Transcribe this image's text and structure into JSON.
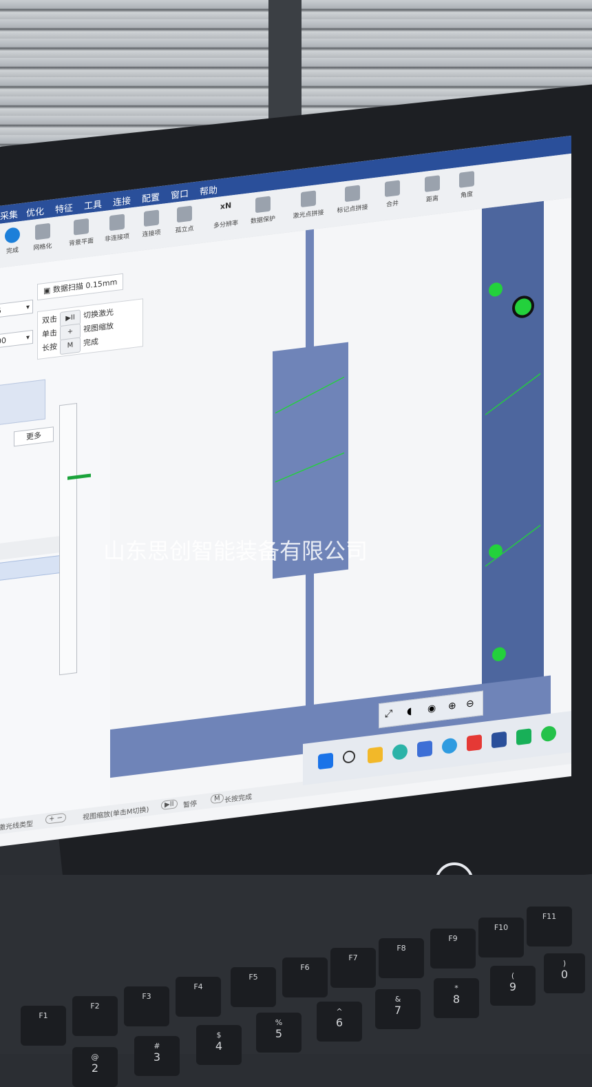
{
  "watermark": "山东思创智能装备有限公司",
  "menubar": {
    "items": [
      "采集",
      "优化",
      "特征",
      "工具",
      "连接",
      "配置",
      "窗口",
      "帮助"
    ]
  },
  "toolbar": {
    "tools": [
      "完成",
      "网格化",
      "背景平面",
      "非连接项",
      "连接项",
      "孤立点",
      "多分辨率",
      "数据保护",
      "激光点拼接",
      "标记点拼接",
      "合并",
      "距离",
      "角度"
    ],
    "resolution_badge": "xN"
  },
  "left_panel": {
    "combo_1": "5",
    "combo_2": "00",
    "more_button": "更多"
  },
  "viewport": {
    "scan_label": "数据扫描 0.15mm",
    "hints": [
      {
        "action": "双击",
        "key": "▶II",
        "desc": "切换激光"
      },
      {
        "action": "单击",
        "key": "+",
        "desc": "视图缩放"
      },
      {
        "action": "长按",
        "key": "M",
        "desc": "完成"
      }
    ]
  },
  "statusbar": {
    "laser_type": "激光线类型",
    "zoom_keys": "+ −",
    "zoom_hint": "视图缩放(单击M切换)",
    "pause_key": "▶II",
    "pause_label": "暂停",
    "finish_key": "M",
    "finish_label": "长按完成"
  },
  "taskbar": {
    "icons": [
      "windows-icon",
      "search-icon",
      "folder-icon",
      "edge-icon",
      "store-icon",
      "browser-icon",
      "wps-icon",
      "app-d-icon",
      "mail-icon",
      "wechat-icon"
    ]
  },
  "keyboard": {
    "fn_keys": [
      {
        "label": "F1"
      },
      {
        "label": "F2"
      },
      {
        "label": "F3"
      },
      {
        "label": "F4"
      },
      {
        "label": "F5"
      },
      {
        "label": "F6"
      },
      {
        "label": "F7"
      },
      {
        "label": "F8"
      },
      {
        "label": "F9"
      },
      {
        "label": "F10"
      },
      {
        "label": "F11"
      }
    ],
    "num_keys": [
      "@",
      "#",
      "$",
      "%",
      "^",
      "&",
      "*",
      "(",
      ")"
    ],
    "num_subs": [
      "2",
      "3",
      "4",
      "5",
      "6",
      "7",
      "8",
      "9",
      "0"
    ]
  },
  "colors": {
    "accent": "#2a4f9a",
    "model_blue": "#6f84b8",
    "target_green": "#23d13c"
  }
}
